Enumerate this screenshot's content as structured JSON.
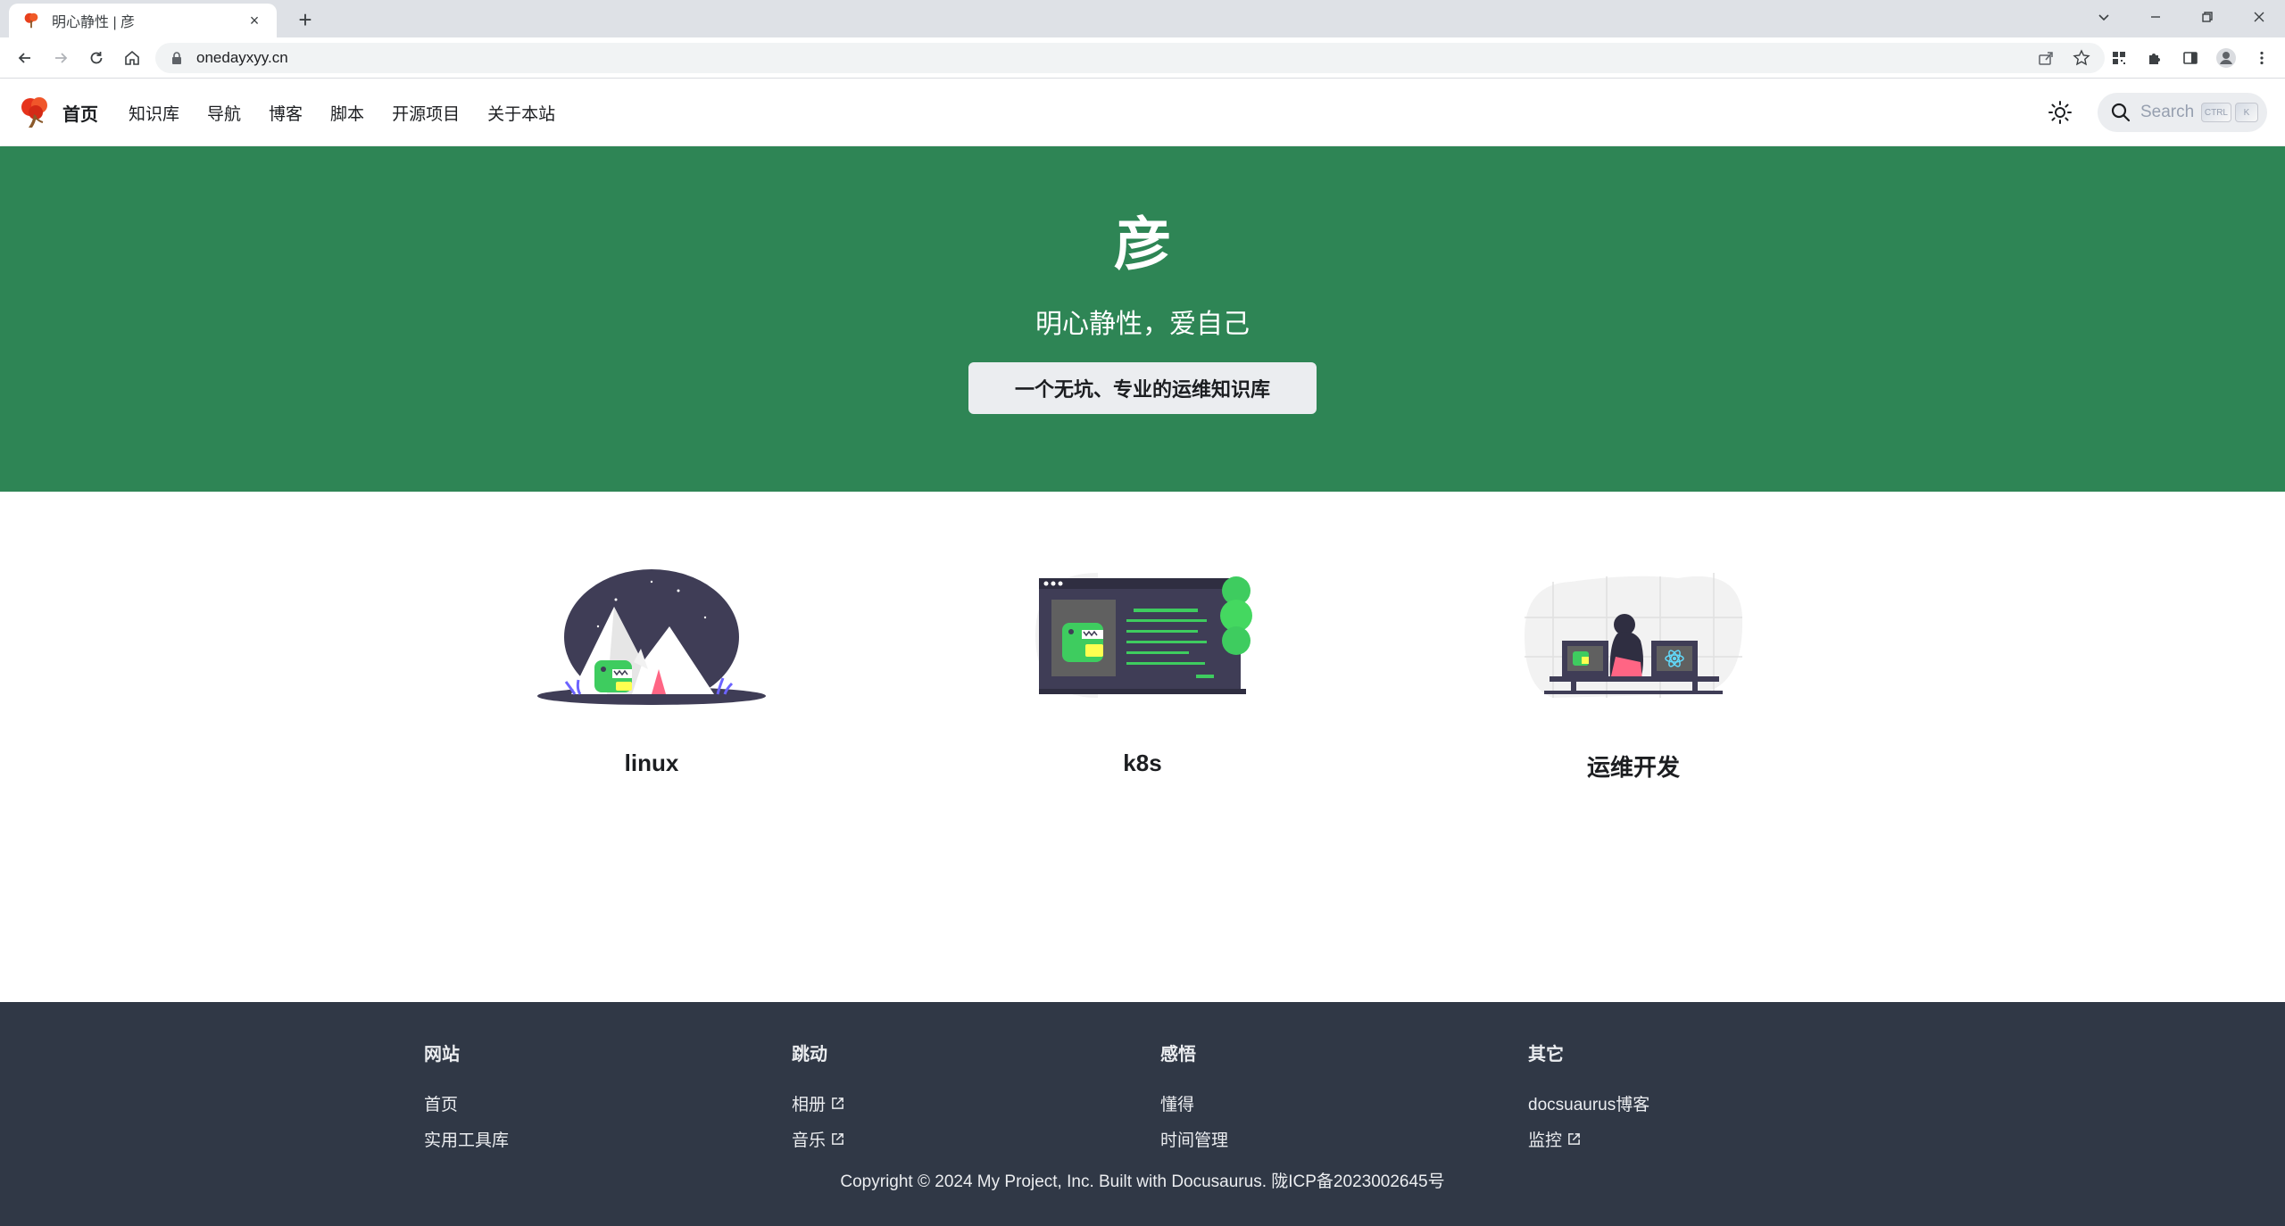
{
  "browser": {
    "tab_title": "明心静性 | 彦",
    "tab_close": "×",
    "new_tab": "+",
    "url": "onedayxyy.cn"
  },
  "navbar": {
    "brand_title": "首页",
    "items": [
      {
        "label": "知识库"
      },
      {
        "label": "导航"
      },
      {
        "label": "博客"
      },
      {
        "label": "脚本"
      },
      {
        "label": "开源项目"
      },
      {
        "label": "关于本站"
      }
    ],
    "search_placeholder": "Search",
    "search_keys": [
      "CTRL",
      "K"
    ]
  },
  "hero": {
    "title": "彦",
    "subtitle": "明心静性，爱自己",
    "button_label": "一个无坑、专业的运维知识库"
  },
  "features": [
    {
      "title": "linux",
      "icon": "mountains-dino-illustration"
    },
    {
      "title": "k8s",
      "icon": "browser-dino-illustration"
    },
    {
      "title": "运维开发",
      "icon": "developer-react-illustration"
    }
  ],
  "footer": {
    "columns": [
      {
        "title": "网站",
        "links": [
          {
            "label": "首页",
            "external": false
          },
          {
            "label": "实用工具库",
            "external": false
          }
        ]
      },
      {
        "title": "跳动",
        "links": [
          {
            "label": "相册",
            "external": true
          },
          {
            "label": "音乐",
            "external": true
          }
        ]
      },
      {
        "title": "感悟",
        "links": [
          {
            "label": "懂得",
            "external": false
          },
          {
            "label": "时间管理",
            "external": false
          }
        ]
      },
      {
        "title": "其它",
        "links": [
          {
            "label": "docsuaurus博客",
            "external": false
          },
          {
            "label": "监控",
            "external": true
          }
        ]
      }
    ],
    "copyright": "Copyright © 2024 My Project, Inc. Built with Docusaurus. 陇ICP备2023002645号"
  },
  "colors": {
    "hero_bg": "#2e8555",
    "footer_bg": "#303846",
    "nav_bg": "#ffffff"
  }
}
